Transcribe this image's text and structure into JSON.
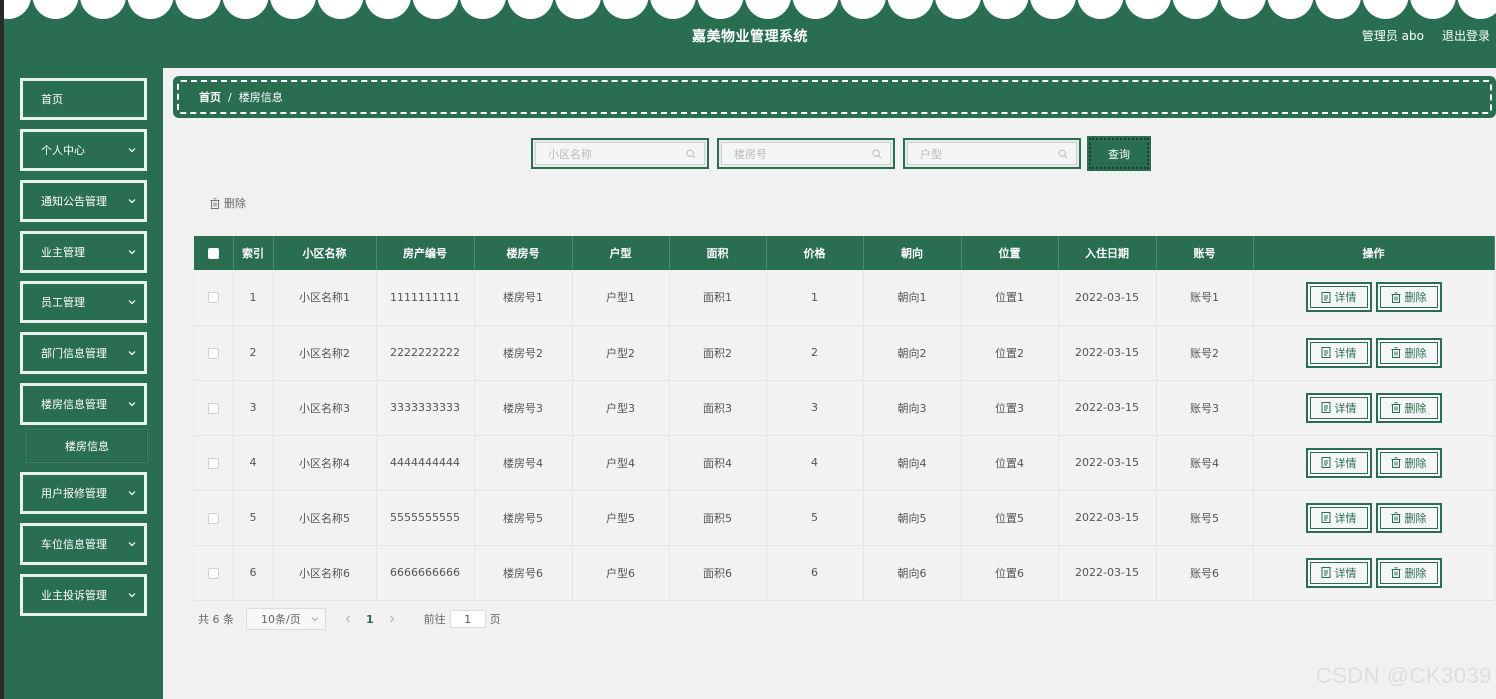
{
  "header": {
    "title": "嘉美物业管理系统",
    "user_label": "管理员 abo",
    "logout_label": "退出登录"
  },
  "sidebar": {
    "items": [
      {
        "label": "首页",
        "has_chevron": false
      },
      {
        "label": "个人中心",
        "has_chevron": true
      },
      {
        "label": "通知公告管理",
        "has_chevron": true
      },
      {
        "label": "业主管理",
        "has_chevron": true
      },
      {
        "label": "员工管理",
        "has_chevron": true
      },
      {
        "label": "部门信息管理",
        "has_chevron": true
      },
      {
        "label": "楼房信息管理",
        "has_chevron": true
      },
      {
        "label": "用户报修管理",
        "has_chevron": true
      },
      {
        "label": "车位信息管理",
        "has_chevron": true
      },
      {
        "label": "业主投诉管理",
        "has_chevron": true
      }
    ],
    "sub_item": "楼房信息"
  },
  "breadcrumb": {
    "home": "首页",
    "separator": "/",
    "current": "楼房信息"
  },
  "search": {
    "community_placeholder": "小区名称",
    "building_placeholder": "楼房号",
    "unit_type_placeholder": "户型",
    "button": "查询"
  },
  "toolbar": {
    "delete": "删除"
  },
  "table": {
    "columns": [
      "索引",
      "小区名称",
      "房产编号",
      "楼房号",
      "户型",
      "面积",
      "价格",
      "朝向",
      "位置",
      "入住日期",
      "账号",
      "操作"
    ],
    "rows": [
      {
        "index": "1",
        "community": "小区名称1",
        "property_no": "1111111111",
        "building": "楼房号1",
        "unit_type": "户型1",
        "area": "面积1",
        "price": "1",
        "orientation": "朝向1",
        "location": "位置1",
        "move_in_date": "2022-03-15",
        "account": "账号1"
      },
      {
        "index": "2",
        "community": "小区名称2",
        "property_no": "2222222222",
        "building": "楼房号2",
        "unit_type": "户型2",
        "area": "面积2",
        "price": "2",
        "orientation": "朝向2",
        "location": "位置2",
        "move_in_date": "2022-03-15",
        "account": "账号2"
      },
      {
        "index": "3",
        "community": "小区名称3",
        "property_no": "3333333333",
        "building": "楼房号3",
        "unit_type": "户型3",
        "area": "面积3",
        "price": "3",
        "orientation": "朝向3",
        "location": "位置3",
        "move_in_date": "2022-03-15",
        "account": "账号3"
      },
      {
        "index": "4",
        "community": "小区名称4",
        "property_no": "4444444444",
        "building": "楼房号4",
        "unit_type": "户型4",
        "area": "面积4",
        "price": "4",
        "orientation": "朝向4",
        "location": "位置4",
        "move_in_date": "2022-03-15",
        "account": "账号4"
      },
      {
        "index": "5",
        "community": "小区名称5",
        "property_no": "5555555555",
        "building": "楼房号5",
        "unit_type": "户型5",
        "area": "面积5",
        "price": "5",
        "orientation": "朝向5",
        "location": "位置5",
        "move_in_date": "2022-03-15",
        "account": "账号5"
      },
      {
        "index": "6",
        "community": "小区名称6",
        "property_no": "6666666666",
        "building": "楼房号6",
        "unit_type": "户型6",
        "area": "面积6",
        "price": "6",
        "orientation": "朝向6",
        "location": "位置6",
        "move_in_date": "2022-03-15",
        "account": "账号6"
      }
    ],
    "detail_label": "详情",
    "delete_label": "删除"
  },
  "pagination": {
    "total": "共 6 条",
    "page_size": "10条/页",
    "current_page": "1",
    "goto_label": "前往",
    "goto_value": "1",
    "page_suffix": "页"
  },
  "watermark": "CSDN @CK3039",
  "colors": {
    "primary": "#2a6e52",
    "background": "#f1f1f1"
  }
}
